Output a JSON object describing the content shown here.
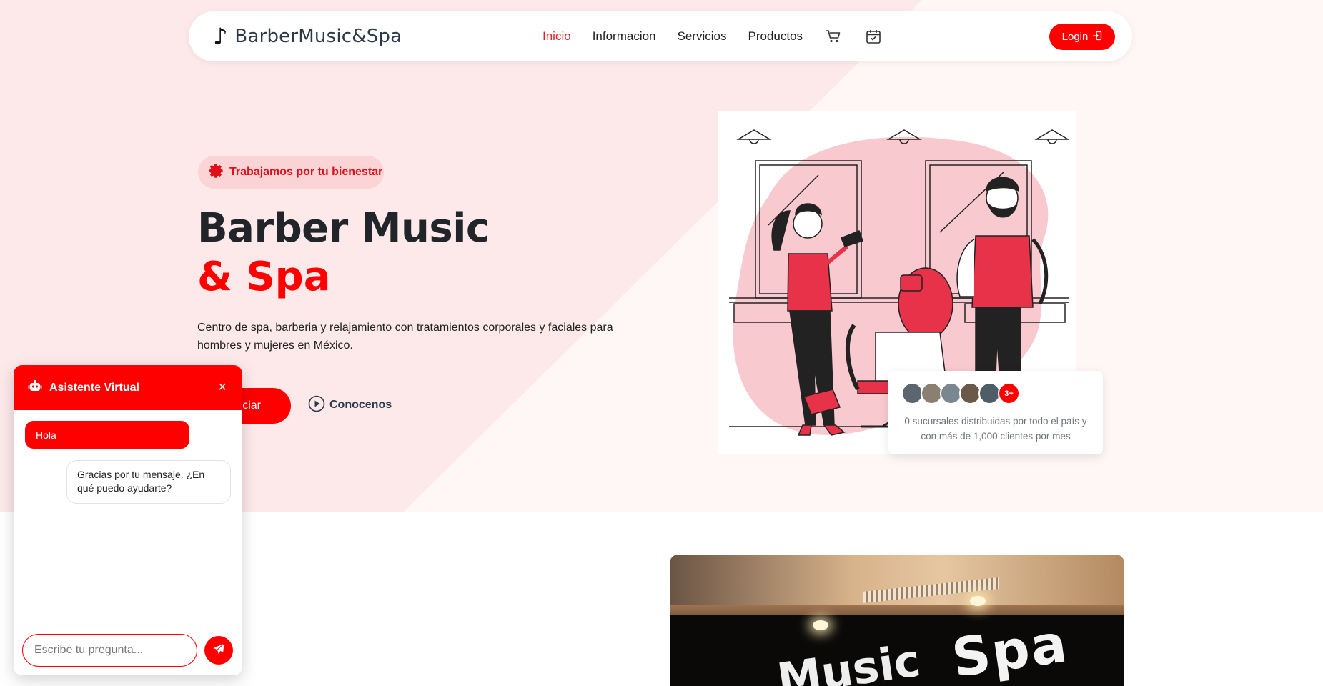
{
  "nav": {
    "brand": "BarberMusic&Spa",
    "links": [
      "Inicio",
      "Informacion",
      "Servicios",
      "Productos"
    ],
    "active": "Inicio",
    "login_label": "Login"
  },
  "hero": {
    "badge": "Trabajamos por tu bienestar",
    "title_line1": "Barber Music",
    "title_line2": "& Spa",
    "description": "Centro de spa, barberia y relajamiento con tratamientos corporales y faciales para hombres y mujeres en México.",
    "cta_label": "ciar",
    "secondary_label": "Conocenos"
  },
  "stats": {
    "more_badge": "3+",
    "text": "0 sucursales distribuidas por todo el país y con más de 1,000 clientes por mes"
  },
  "photo": {
    "sign_word1": "Music",
    "sign_word2": "Spa"
  },
  "chat": {
    "title": "Asistente Virtual",
    "close": "×",
    "user_message": "Hola",
    "bot_message": "Gracias por tu mensaje. ¿En qué puedo ayudarte?",
    "input_placeholder": "Escribe tu pregunta..."
  },
  "colors": {
    "brand_red": "#fe0000",
    "hero_bg": "#fde9ea",
    "illustration_pink": "#f8c9ce"
  }
}
